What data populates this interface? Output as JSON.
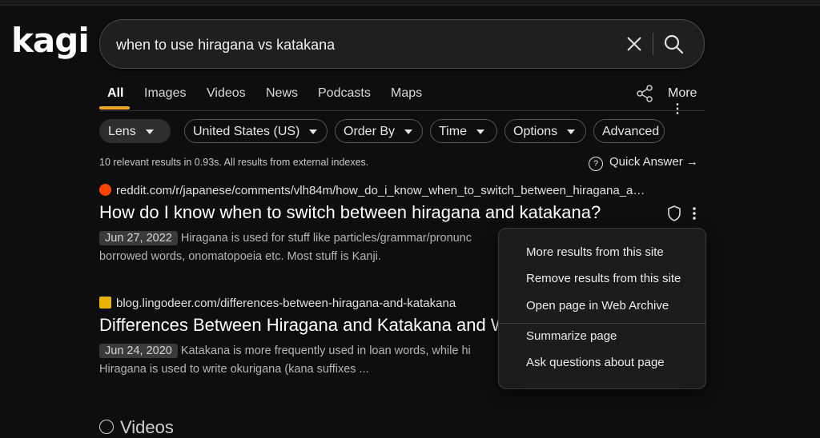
{
  "app": {
    "logo": "kagi"
  },
  "search": {
    "query": "when to use hiragana vs katakana"
  },
  "tabs": [
    {
      "label": "All",
      "active": true
    },
    {
      "label": "Images"
    },
    {
      "label": "Videos"
    },
    {
      "label": "News"
    },
    {
      "label": "Podcasts"
    },
    {
      "label": "Maps"
    }
  ],
  "more_label": "More",
  "filters": [
    {
      "label": "Lens",
      "dropdown": true
    },
    {
      "label": "United States (US)",
      "dropdown": true
    },
    {
      "label": "Order By",
      "dropdown": true
    },
    {
      "label": "Time",
      "dropdown": true
    },
    {
      "label": "Options",
      "dropdown": true
    },
    {
      "label": "Advanced",
      "dropdown": false
    }
  ],
  "stats": "10 relevant results in 0.93s. All results from external indexes.",
  "quick_answer": {
    "label": "Quick Answer →",
    "icon": "?"
  },
  "results": [
    {
      "url": "reddit.com/r/japanese/comments/vlh84m/how_do_i_know_when_to_switch_between_hiragana_a…",
      "title": "How do I know when to switch between hiragana and katakana?",
      "date": "Jun 27, 2022",
      "snippet_line1": "Hiragana is used for stuff like particles/grammar/pronunc",
      "snippet_line2": "borrowed words, onomatopoeia etc. Most stuff is Kanji.",
      "favicon_color": "#ff4500"
    },
    {
      "url": "blog.lingodeer.com/differences-between-hiragana-and-katakana",
      "title": "Differences Between Hiragana and Katakana and W",
      "date": "Jun 24, 2020",
      "snippet_line1": "Katakana is more frequently used in loan words, while hi",
      "snippet_line2": "Hiragana is used to write okurigana (kana suffixes ...",
      "favicon_color": "#e8b400"
    }
  ],
  "context_menu": {
    "items": [
      "More results from this site",
      "Remove results from this site",
      "Open page in Web Archive",
      "Summarize page",
      "Ask questions about page"
    ]
  },
  "videos_heading": "Videos",
  "colors": {
    "accent": "#f5a623",
    "background": "#0e0e0e"
  }
}
